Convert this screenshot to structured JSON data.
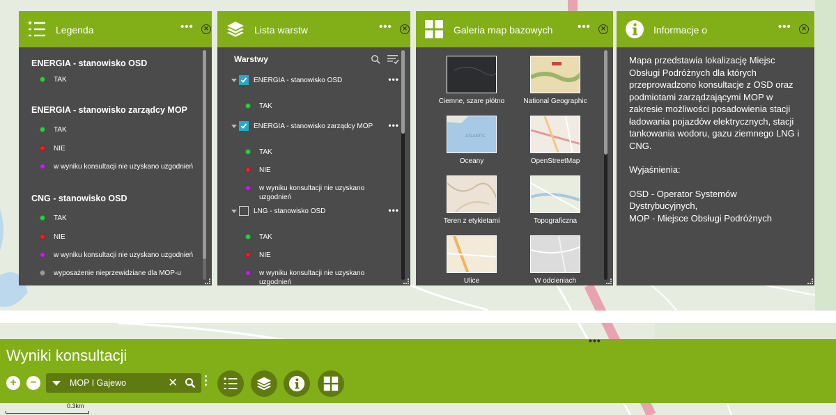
{
  "legend": {
    "title": "Legenda",
    "sections": [
      {
        "title": "ENERGIA - stanowisko OSD",
        "items": [
          {
            "label": "TAK",
            "color": "#2ecc40"
          }
        ]
      },
      {
        "title": "ENERGIA - stanowisko zarządcy MOP",
        "items": [
          {
            "label": "TAK",
            "color": "#2ecc40"
          },
          {
            "label": "NIE",
            "color": "#e0262b"
          },
          {
            "label": "w wyniku konsultacji nie uzyskano uzgodnień",
            "color": "#b42bd6"
          }
        ]
      },
      {
        "title": "CNG - stanowisko OSD",
        "items": [
          {
            "label": "TAK",
            "color": "#2ecc40"
          },
          {
            "label": "NIE",
            "color": "#e0262b"
          },
          {
            "label": "w wyniku konsultacji nie uzyskano uzgodnień",
            "color": "#b42bd6"
          },
          {
            "label": "wyposażenie nieprzewidziane dla MOP-u",
            "color": "#9b9b9b"
          }
        ]
      }
    ]
  },
  "layers": {
    "title": "Lista warstw",
    "section_label": "Warstwy",
    "groups": [
      {
        "name": "ENERGIA - stanowisko OSD",
        "checked": true,
        "items": [
          {
            "label": "TAK",
            "color": "#2ecc40"
          }
        ]
      },
      {
        "name": "ENERGIA - stanowisko zarządcy MOP",
        "checked": true,
        "items": [
          {
            "label": "TAK",
            "color": "#2ecc40"
          },
          {
            "label": "NIE",
            "color": "#e0262b"
          },
          {
            "label": "w wyniku konsultacji nie uzyskano uzgodnień",
            "color": "#b42bd6"
          }
        ]
      },
      {
        "name": "LNG - stanowisko OSD",
        "checked": false,
        "items": [
          {
            "label": "TAK",
            "color": "#2ecc40"
          },
          {
            "label": "NIE",
            "color": "#e0262b"
          },
          {
            "label": "w wyniku konsultacji nie uzyskano uzgodnień",
            "color": "#b42bd6"
          }
        ]
      }
    ]
  },
  "gallery": {
    "title": "Galeria map bazowych",
    "maps": [
      {
        "label": "Ciemne, szare płótno",
        "icon": "dark-gray-basemap"
      },
      {
        "label": "National Geographic",
        "icon": "natgeo-basemap"
      },
      {
        "label": "Oceany",
        "icon": "oceans-basemap"
      },
      {
        "label": "OpenStreetMap",
        "icon": "osm-basemap"
      },
      {
        "label": "Teren z etykietami",
        "icon": "terrain-basemap"
      },
      {
        "label": "Topograficzna",
        "icon": "topo-basemap"
      },
      {
        "label": "Ulice",
        "icon": "streets-basemap"
      },
      {
        "label": "W odcieniach",
        "icon": "light-gray-basemap"
      }
    ]
  },
  "info": {
    "title": "Informacje o",
    "paragraphs": [
      "Mapa przedstawia lokalizację Miejsc Obsługi Podróżnych dla których przeprowadzono konsultacje z OSD oraz podmiotami zarządzającymi MOP w zakresie możliwości posadowienia stacji ładowania pojazdów elektrycznych, stacji tankowania wodoru, gazu ziemnego LNG i CNG.",
      "Wyjaśnienia:",
      "OSD - Operator Systemów Dystrybucyjnych,\nMOP - Miejsce Obsługi Podróżnych"
    ]
  },
  "bottom": {
    "title": "Wyniki konsultacji",
    "search_value": "MOP I Gajewo",
    "zoom_in": "+",
    "zoom_out": "−"
  },
  "map": {
    "scale_label": "0.3km"
  },
  "colors": {
    "accent": "#82ae18",
    "accent_dark": "#5e7a10",
    "panel": "#4b4b4b"
  }
}
